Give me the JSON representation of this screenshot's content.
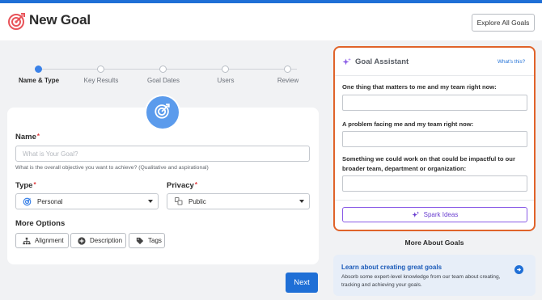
{
  "header": {
    "title": "New Goal",
    "explore_label": "Explore All Goals"
  },
  "stepper": {
    "steps": [
      {
        "label": "Name & Type",
        "active": true
      },
      {
        "label": "Key Results",
        "active": false
      },
      {
        "label": "Goal Dates",
        "active": false
      },
      {
        "label": "Users",
        "active": false
      },
      {
        "label": "Review",
        "active": false
      }
    ]
  },
  "form": {
    "name_label": "Name",
    "name_placeholder": "What is Your Goal?",
    "name_helper": "What is the overall objective you want to achieve? (Qualitative and aspirational)",
    "type_label": "Type",
    "type_value": "Personal",
    "privacy_label": "Privacy",
    "privacy_value": "Public",
    "required_mark": "*",
    "more_options_label": "More Options",
    "options": {
      "alignment": "Alignment",
      "description": "Description",
      "tags": "Tags"
    },
    "next_label": "Next"
  },
  "assistant": {
    "title": "Goal Assistant",
    "whats_this": "What's this?",
    "q1": "One thing that matters to me and my team right now:",
    "q2": "A problem facing me and my team right now:",
    "q3": "Something we could work on that could be impactful to our broader team, department or organization:",
    "spark_label": "Spark Ideas"
  },
  "more_goals": {
    "title": "More About Goals",
    "card_title": "Learn about creating great goals",
    "card_body": "Absorb some expert-level knowledge from our team about creating, tracking and achieving your goals."
  },
  "colors": {
    "brand_blue": "#1f6fd6",
    "assistant_border": "#e0632a",
    "required_red": "#e0363a",
    "spark_purple": "#6a3fd0"
  },
  "icons": {
    "logo": "target-icon",
    "assistant": "sparkle-icon",
    "type": "target-icon",
    "privacy": "people-icon",
    "alignment": "hierarchy-icon",
    "description": "plus-circle-icon",
    "tags": "tag-icon",
    "learn": "arrow-circle-icon"
  }
}
